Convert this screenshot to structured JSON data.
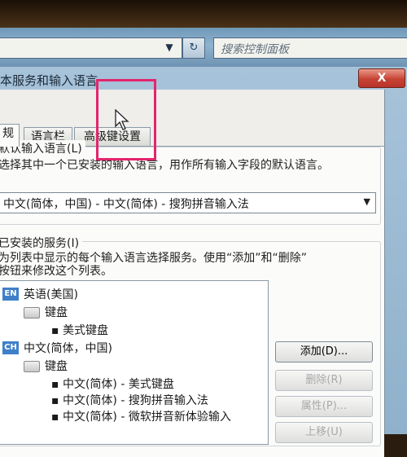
{
  "toolbar": {
    "search_placeholder": "搜索控制面板",
    "dropdown_glyph": "▼",
    "refresh_glyph": "↻"
  },
  "dialog": {
    "title": "本服务和输入语言",
    "close_glyph": "X",
    "tabs": [
      "规",
      "语言栏",
      "高级键设置"
    ],
    "default_language": {
      "heading": "默认输入语言(L)",
      "description": "选择其中一个已安装的输入语言，用作所有输入字段的默认语言。",
      "selected": "中文(简体，中国) - 中文(简体) - 搜狗拼音输入法",
      "arrow": "▼"
    },
    "installed": {
      "heading": "已安装的服务(I)",
      "description_line1": "为列表中显示的每个输入语言选择服务。使用“添加”和“删除”",
      "description_line2": "按钮来修改这个列表。",
      "tree": {
        "lang1": {
          "code": "EN",
          "name": "英语(美国)",
          "group": "键盘",
          "items": [
            "美式键盘"
          ]
        },
        "lang2": {
          "code": "CH",
          "name": "中文(简体，中国)",
          "group": "键盘",
          "items": [
            "中文(简体) - 美式键盘",
            "中文(简体) - 搜狗拼音输入法",
            "中文(简体) - 微软拼音新体验输入"
          ]
        }
      }
    },
    "buttons": {
      "add": "添加(D)...",
      "remove": "删除(R)",
      "properties": "属性(P)...",
      "move_up": "上移(U)"
    }
  },
  "colors": {
    "highlight": "#e3256d",
    "close_button": "#c74334",
    "lang_icon": "#3f7fc9"
  }
}
